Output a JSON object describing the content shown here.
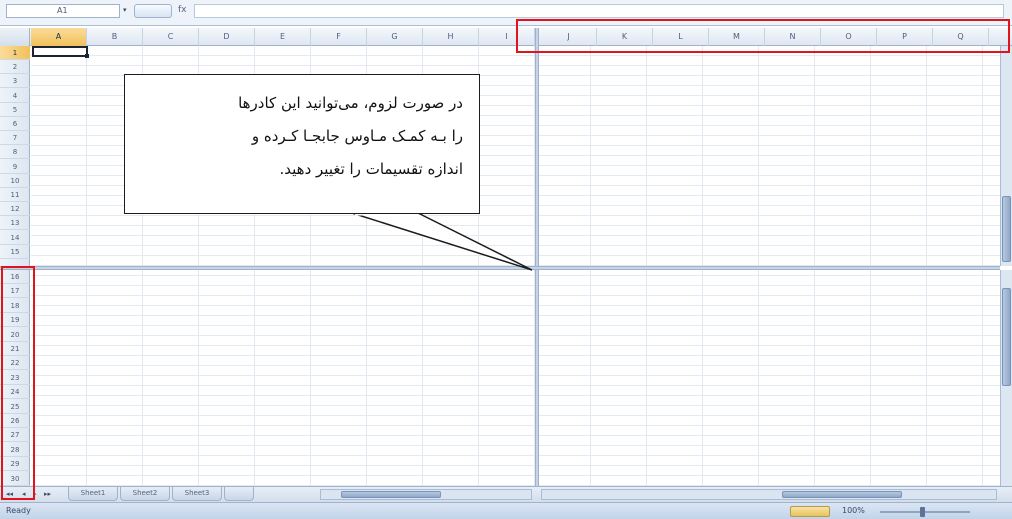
{
  "formula_bar": {
    "name_box_value": "A1",
    "name_box_arrow": "▾",
    "fx_label": "fx"
  },
  "columns": [
    "A",
    "B",
    "C",
    "D",
    "E",
    "F",
    "G",
    "H",
    "I",
    "J",
    "K",
    "L",
    "M",
    "N",
    "O",
    "P",
    "Q"
  ],
  "selected_column": "A",
  "rows": [
    "1",
    "2",
    "3",
    "4",
    "5",
    "6",
    "7",
    "8",
    "9",
    "10",
    "11",
    "12",
    "13",
    "14",
    "15",
    "16",
    "17",
    "18",
    "19",
    "20",
    "21",
    "22",
    "23",
    "24",
    "25",
    "26",
    "27",
    "28",
    "29",
    "30"
  ],
  "selected_row": "1",
  "sheet_tabs": {
    "nav_first": "◂◂",
    "nav_prev": "◂",
    "nav_next": "▸",
    "nav_last": "▸▸",
    "tabs": [
      {
        "label": "Sheet1",
        "active": true
      },
      {
        "label": "Sheet2",
        "active": false
      },
      {
        "label": "Sheet3",
        "active": false
      }
    ]
  },
  "status_bar": {
    "status_text": "Ready",
    "zoom_level": "100%"
  },
  "callout": {
    "lines": [
      "در صورت لزوم، می‌توانید این کادرها",
      "را بـه کمـک مـاوس جابجـا کـرده و",
      "اندازه تقسیمات را تغییر دهید."
    ]
  },
  "colors": {
    "highlight": "#e0141b",
    "selected_header": "#f2c15a",
    "split_bar": "#c6d4e5"
  }
}
